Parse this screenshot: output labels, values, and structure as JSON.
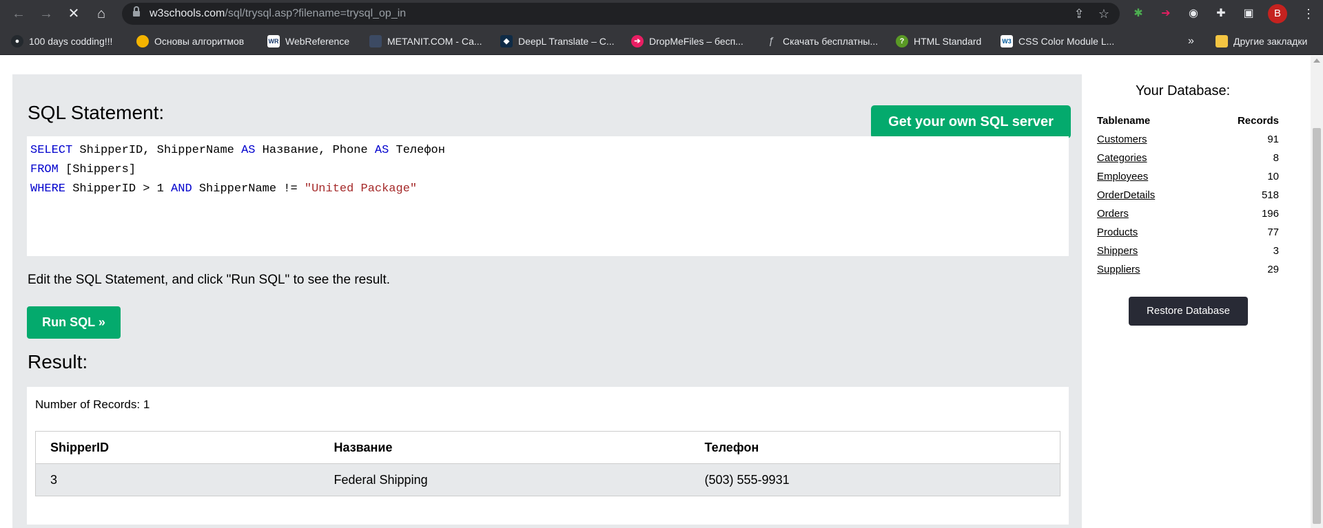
{
  "browser": {
    "url_host": "w3schools.com",
    "url_path": "/sql/trysql.asp?filename=trysql_op_in",
    "profile_initial": "B",
    "bookmarks": [
      {
        "label": "100 days codding!!!",
        "icon": "github-icon",
        "color": "#24292e"
      },
      {
        "label": "Основы алгоритмов",
        "icon": "colorful-circle-icon",
        "color": "#f4b400"
      },
      {
        "label": "WebReference",
        "icon": "wr-icon",
        "color": "#ffffff"
      },
      {
        "label": "METANIT.COM - Са...",
        "icon": "metanit-icon",
        "color": "#3c4a63"
      },
      {
        "label": "DeepL Translate – С...",
        "icon": "deepl-icon",
        "color": "#0f2b46"
      },
      {
        "label": "DropMeFiles – бесп...",
        "icon": "dropmefiles-icon",
        "color": "#e91e63"
      },
      {
        "label": "Скачать бесплатны...",
        "icon": "fs-icon",
        "color": "#35363a"
      },
      {
        "label": "HTML Standard",
        "icon": "whatwg-icon",
        "color": "#5a9a25"
      },
      {
        "label": "CSS Color Module L...",
        "icon": "w3c-icon",
        "color": "#ffffff"
      }
    ],
    "more_bookmarks": "»",
    "other_bookmarks": "Другие закладки"
  },
  "editor": {
    "heading": "SQL Statement:",
    "get_server_label": "Get your own SQL server",
    "line1": {
      "kw1": "SELECT",
      "t1": " ShipperID, ShipperName ",
      "kw2": "AS",
      "t2": " Название, Phone ",
      "kw3": "AS",
      "t3": " Телефон"
    },
    "line2": {
      "kw1": "FROM",
      "t1": " [Shippers]"
    },
    "line3": {
      "kw1": "WHERE",
      "t1": " ShipperID > 1 ",
      "kw2": "AND",
      "t2": " ShipperName != ",
      "str": "\"United Package\""
    },
    "instructions": "Edit the SQL Statement, and click \"Run SQL\" to see the result.",
    "run_label": "Run SQL »"
  },
  "result": {
    "heading": "Result:",
    "record_count": "Number of Records: 1",
    "columns": [
      "ShipperID",
      "Название",
      "Телефон"
    ],
    "rows": [
      [
        "3",
        "Federal Shipping",
        "(503) 555-9931"
      ]
    ]
  },
  "database": {
    "title": "Your Database:",
    "col_name": "Tablename",
    "col_records": "Records",
    "tables": [
      {
        "name": "Customers",
        "records": "91"
      },
      {
        "name": "Categories",
        "records": "8"
      },
      {
        "name": "Employees",
        "records": "10"
      },
      {
        "name": "OrderDetails",
        "records": "518"
      },
      {
        "name": "Orders",
        "records": "196"
      },
      {
        "name": "Products",
        "records": "77"
      },
      {
        "name": "Shippers",
        "records": "3"
      },
      {
        "name": "Suppliers",
        "records": "29"
      }
    ],
    "restore_label": "Restore Database"
  },
  "colors": {
    "accent_green": "#04aa6d",
    "panel_gray": "#e7e9eb",
    "dark_button": "#282a35",
    "keyword_blue": "#0000cd",
    "string_brown": "#a52a2a"
  }
}
